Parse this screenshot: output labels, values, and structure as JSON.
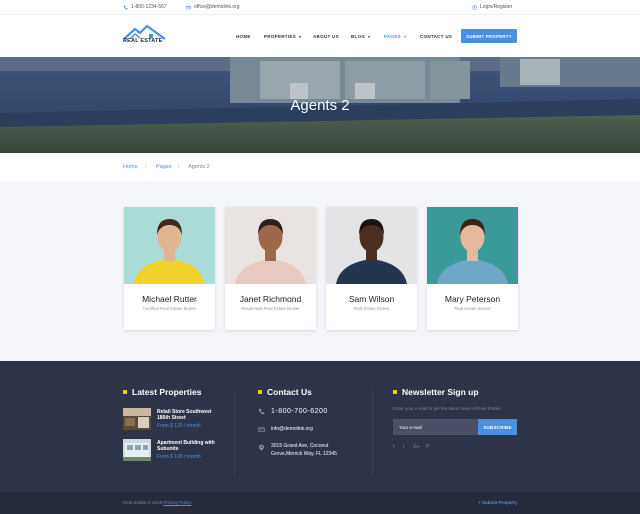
{
  "topbar": {
    "phone": "1-800-1234-567",
    "email": "office@demolink.org",
    "login": "Login/Register"
  },
  "header": {
    "logo_text": "REAL ESTATE",
    "nav": [
      {
        "label": "HOME",
        "dropdown": false,
        "active": false
      },
      {
        "label": "PROPERTIES",
        "dropdown": true,
        "active": false
      },
      {
        "label": "ABOUT US",
        "dropdown": false,
        "active": false
      },
      {
        "label": "BLOG",
        "dropdown": true,
        "active": false
      },
      {
        "label": "PAGES",
        "dropdown": true,
        "active": true
      },
      {
        "label": "CONTACT US",
        "dropdown": false,
        "active": false
      }
    ],
    "submit_label": "SUBMIT PROPERTY"
  },
  "hero": {
    "title": "Agents 2"
  },
  "breadcrumb": {
    "home": "Home",
    "pages": "Pages",
    "current": "Agents 2"
  },
  "agents": [
    {
      "name": "Michael Rutter",
      "role": "Certified Real Estate Broker",
      "bg": "#a9dcd6",
      "shirt": "#f0d22a",
      "skin": "#e2b592",
      "hair": "#3b2a20"
    },
    {
      "name": "Janet Richmond",
      "role": "Residential Real Estate Broker",
      "bg": "#e9e4e1",
      "shirt": "#e8c9c2",
      "skin": "#9b6a4c",
      "hair": "#2e2018"
    },
    {
      "name": "Sam Wilson",
      "role": "Real Estate Broker",
      "bg": "#e4e4e7",
      "shirt": "#24364f",
      "skin": "#4a2f22",
      "hair": "#1b1210"
    },
    {
      "name": "Mary Peterson",
      "role": "Real Estate Broker",
      "bg": "#3a9a98",
      "shirt": "#6fa8c6",
      "skin": "#e4b99c",
      "hair": "#3b2318"
    }
  ],
  "footer": {
    "latest_title": "Latest Properties",
    "properties": [
      {
        "title": "Retail Store Southwest 186th Street",
        "price": "From $ 120 / month"
      },
      {
        "title": "Apartment Building with Subunits",
        "price": "From $ 120 / month"
      }
    ],
    "contact_title": "Contact Us",
    "contact": {
      "phone": "1-800-700-6200",
      "email": "info@demolink.org",
      "address": "3015 Grand Ave, Coconut Grove,Merrick Way, FL 12345"
    },
    "newsletter_title": "Newsletter Sign up",
    "newsletter_desc": "Enter your e-mail to get the latest news of Real Estate",
    "email_placeholder": "Your e-mail",
    "subscribe_label": "SUBSCRIBE",
    "social": [
      "f",
      "t",
      "G+",
      "P"
    ]
  },
  "bottom": {
    "copyright": "Real Estate © 2016",
    "privacy": "Privacy Policy",
    "submit": "+ Submit Property"
  },
  "colors": {
    "accent": "#4a90e2",
    "footer_bg": "#2e3447",
    "highlight": "#f5c518"
  }
}
